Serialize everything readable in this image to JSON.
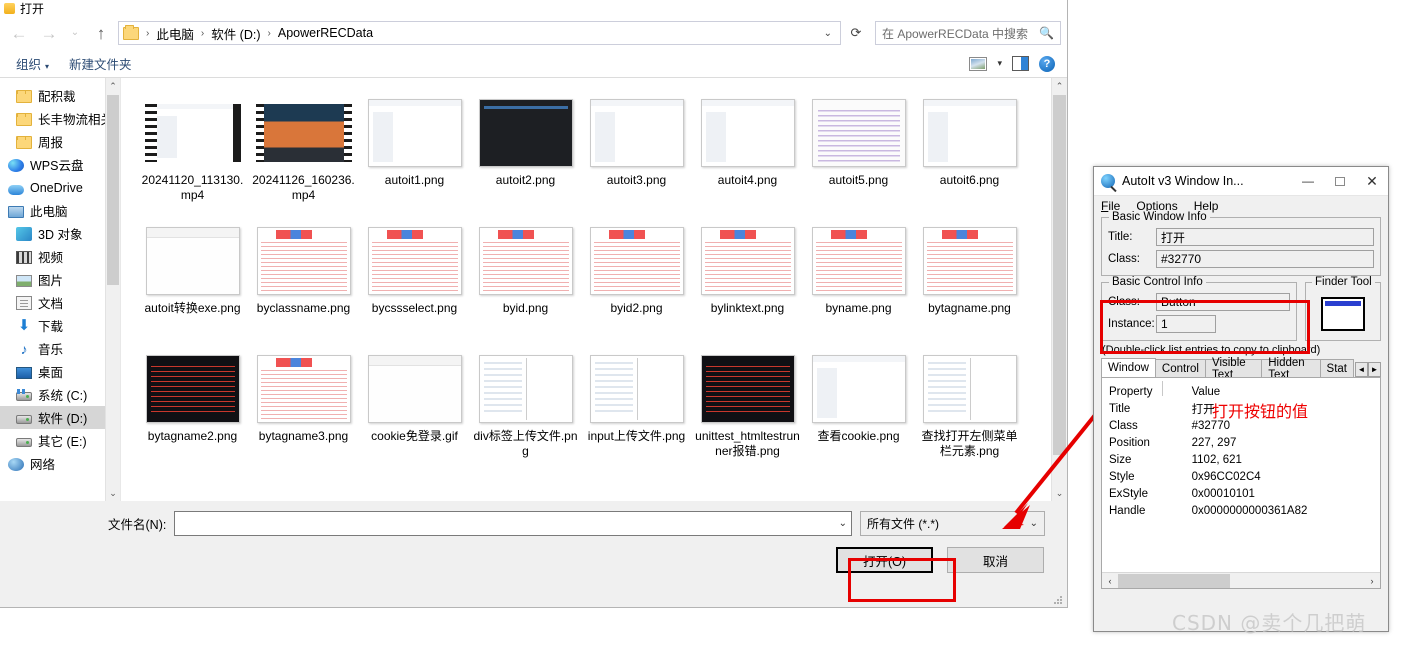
{
  "dialog": {
    "title": "打开",
    "window_icon": "folder-icon",
    "nav": {
      "back": "←",
      "forward": "→",
      "recent": "⌄",
      "up": "↑",
      "refresh": "⟳",
      "breadcrumb": [
        "此电脑",
        "软件 (D:)",
        "ApowerRECData"
      ],
      "breadcrumb_separator": "›",
      "dropdown_caret": "⌄"
    },
    "search": {
      "placeholder": "在 ApowerRECData 中搜索",
      "icon": "search-icon"
    },
    "command_bar": {
      "organize": "组织",
      "organize_caret": "▾",
      "new_folder": "新建文件夹",
      "view_icon": "view-layout-icon",
      "view_caret": "▾",
      "preview_pane_icon": "preview-pane-icon",
      "help_icon": "?"
    },
    "sidebar": {
      "items": [
        {
          "label": "配积裁",
          "icon": "folder-icon",
          "indent": 1,
          "selected": false
        },
        {
          "label": "长丰物流相关文",
          "icon": "folder-icon",
          "indent": 1,
          "selected": false
        },
        {
          "label": "周报",
          "icon": "folder-icon",
          "indent": 1,
          "selected": false
        },
        {
          "label": "WPS云盘",
          "icon": "wps-cloud-icon",
          "indent": 0,
          "selected": false
        },
        {
          "label": "OneDrive",
          "icon": "onedrive-cloud-icon",
          "indent": 0,
          "selected": false
        },
        {
          "label": "此电脑",
          "icon": "this-pc-icon",
          "indent": 0,
          "selected": false
        },
        {
          "label": "3D 对象",
          "icon": "3d-objects-icon",
          "indent": 1,
          "selected": false
        },
        {
          "label": "视频",
          "icon": "videos-icon",
          "indent": 1,
          "selected": false
        },
        {
          "label": "图片",
          "icon": "pictures-icon",
          "indent": 1,
          "selected": false
        },
        {
          "label": "文档",
          "icon": "documents-icon",
          "indent": 1,
          "selected": false
        },
        {
          "label": "下载",
          "icon": "downloads-icon",
          "indent": 1,
          "selected": false
        },
        {
          "label": "音乐",
          "icon": "music-icon",
          "indent": 1,
          "selected": false
        },
        {
          "label": "桌面",
          "icon": "desktop-icon",
          "indent": 1,
          "selected": false
        },
        {
          "label": "系统 (C:)",
          "icon": "system-drive-icon",
          "indent": 1,
          "selected": false
        },
        {
          "label": "软件 (D:)",
          "icon": "drive-icon",
          "indent": 1,
          "selected": true
        },
        {
          "label": "其它 (E:)",
          "icon": "drive-icon",
          "indent": 1,
          "selected": false
        },
        {
          "label": "网络",
          "icon": "network-icon",
          "indent": 0,
          "selected": false
        }
      ],
      "scroll_up": "⌃",
      "scroll_down": "⌄"
    },
    "files": [
      {
        "name": "20241120_113130.mp4",
        "kind": "video",
        "thumb": "tb-ui"
      },
      {
        "name": "20241126_160236.mp4",
        "kind": "video",
        "thumb": "tb-photo"
      },
      {
        "name": "autoit1.png",
        "kind": "image",
        "thumb": "tb-ui"
      },
      {
        "name": "autoit2.png",
        "kind": "image",
        "thumb": "tb-dark"
      },
      {
        "name": "autoit3.png",
        "kind": "image",
        "thumb": "tb-ui"
      },
      {
        "name": "autoit4.png",
        "kind": "image",
        "thumb": "tb-ui"
      },
      {
        "name": "autoit5.png",
        "kind": "image",
        "thumb": "tb-code"
      },
      {
        "name": "autoit6.png",
        "kind": "image",
        "thumb": "tb-ui"
      },
      {
        "name": "autoit转换exe.png",
        "kind": "image",
        "thumb": "tb-blank"
      },
      {
        "name": "byclassname.png",
        "kind": "image",
        "thumb": "tb-web"
      },
      {
        "name": "bycssselect.png",
        "kind": "image",
        "thumb": "tb-web"
      },
      {
        "name": "byid.png",
        "kind": "image",
        "thumb": "tb-web"
      },
      {
        "name": "byid2.png",
        "kind": "image",
        "thumb": "tb-web"
      },
      {
        "name": "bylinktext.png",
        "kind": "image",
        "thumb": "tb-web"
      },
      {
        "name": "byname.png",
        "kind": "image",
        "thumb": "tb-web"
      },
      {
        "name": "bytagname.png",
        "kind": "image",
        "thumb": "tb-web"
      },
      {
        "name": "bytagname2.png",
        "kind": "image",
        "thumb": "tb-term"
      },
      {
        "name": "bytagname3.png",
        "kind": "image",
        "thumb": "tb-web"
      },
      {
        "name": "cookie免登录.gif",
        "kind": "image",
        "thumb": "tb-blank"
      },
      {
        "name": "div标签上传文件.png",
        "kind": "image",
        "thumb": "tb-split"
      },
      {
        "name": "input上传文件.png",
        "kind": "image",
        "thumb": "tb-split"
      },
      {
        "name": "unittest_htmltestrunner报错.png",
        "kind": "image",
        "thumb": "tb-term"
      },
      {
        "name": "查看cookie.png",
        "kind": "image",
        "thumb": "tb-ui"
      },
      {
        "name": "查找打开左侧菜单栏元素.png",
        "kind": "image",
        "thumb": "tb-split"
      }
    ],
    "footer": {
      "filename_label": "文件名(N):",
      "filename_value": "",
      "filename_caret": "⌄",
      "filter_value": "所有文件 (*.*)",
      "filter_caret": "⌄",
      "open_button": "打开(O)",
      "cancel_button": "取消"
    }
  },
  "autoit": {
    "title": "AutoIt v3 Window In...",
    "app_icon": "autoit-magnifier-icon",
    "window_controls": {
      "minimize": "—",
      "maximize": "□",
      "close": "✕"
    },
    "menu": [
      "File",
      "Options",
      "Help"
    ],
    "basic_window_info": {
      "legend": "Basic Window Info",
      "title_label": "Title:",
      "title_value": "打开",
      "class_label": "Class:",
      "class_value": "#32770"
    },
    "basic_control_info": {
      "legend": "Basic Control Info",
      "class_label": "Class:",
      "class_value": "Button",
      "instance_label": "Instance:",
      "instance_value": "1"
    },
    "finder_tool": {
      "legend": "Finder Tool",
      "icon": "finder-window-icon"
    },
    "hint": "(Double-click list entries to copy to clipboard)",
    "tabs": [
      {
        "label": "Window",
        "active": true
      },
      {
        "label": "Control",
        "active": false
      },
      {
        "label": "Visible Text",
        "active": false
      },
      {
        "label": "Hidden Text",
        "active": false
      },
      {
        "label": "Stat",
        "active": false
      }
    ],
    "tab_scroll": {
      "left": "◄",
      "right": "►"
    },
    "property_table": {
      "headers": [
        "Property",
        "Value"
      ],
      "rows": [
        [
          "Title",
          "打开"
        ],
        [
          "Class",
          "#32770"
        ],
        [
          "Position",
          "227, 297"
        ],
        [
          "Size",
          "1102, 621"
        ],
        [
          "Style",
          "0x96CC02C4"
        ],
        [
          "ExStyle",
          "0x00010101"
        ],
        [
          "Handle",
          "0x0000000000361A82"
        ]
      ]
    },
    "annotation": "打开按钮的值",
    "annotation_color": "#ee0000",
    "hscroll": {
      "left": "‹",
      "right": "›"
    }
  },
  "watermark": "CSDN @卖个几把萌",
  "highlight_color": "#e60000"
}
